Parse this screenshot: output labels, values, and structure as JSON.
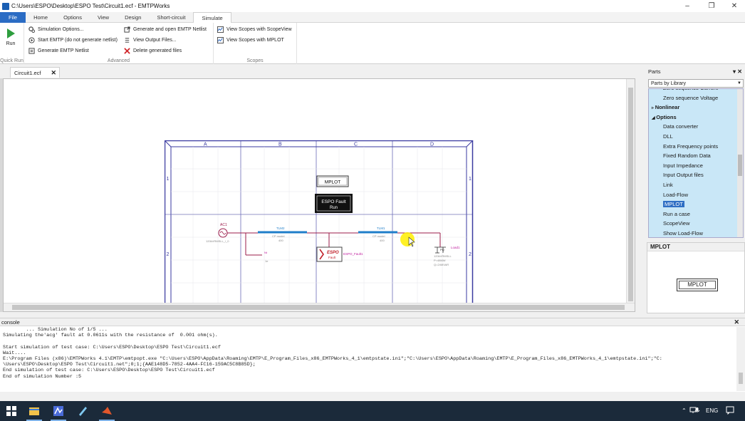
{
  "window": {
    "title": "C:\\Users\\ESPO\\Desktop\\ESPO Test\\Circuit1.ecf - EMTPWorks",
    "minimize": "–",
    "maximize": "❐",
    "close": "✕"
  },
  "menu_tabs": [
    "File",
    "Home",
    "Options",
    "View",
    "Design",
    "Short-circuit",
    "Simulate"
  ],
  "active_tab": "Simulate",
  "ribbon": {
    "run_label": "Run",
    "quick_run_label": "Quick Run",
    "advanced": {
      "label": "Advanced",
      "items": [
        "Simulation Options...",
        "Start EMTP (do not generate netlist)",
        "Generate EMTP Netlist",
        "Generate and open EMTP Netlist",
        "View Output Files...",
        "Delete generated files"
      ]
    },
    "scopes": {
      "label": "Scopes",
      "items": [
        "View Scopes with ScopeView",
        "View Scopes with MPLOT"
      ]
    }
  },
  "document_tab": {
    "label": "Circuit1.ecf",
    "close": "✕"
  },
  "schematic": {
    "columns": [
      "A",
      "B",
      "C",
      "D"
    ],
    "rows": [
      "1",
      "2"
    ],
    "mplot_label": "MPLOT",
    "espo_fault_line1": "ESPO Fault",
    "espo_fault_line2": "Run",
    "source_label": "AC1",
    "source_rating": "120kVRMSLL_/_0",
    "line1_label": "TLM2",
    "line1_type": "CP model",
    "line1_len": "400",
    "line2_label": "TLM1",
    "line2_type": "CP model",
    "line2_len": "400",
    "fault_block_label": "ESPO",
    "fault_block_sub": "Fault",
    "fault_tag": "ESPO_Fault1",
    "load_label": "Load1",
    "load_rating1": "120kVRMSLL",
    "load_rating2": "P=48MW",
    "load_rating3": "Q=24MVAR",
    "load_pq": "PQ",
    "ground_label": "Nt",
    "ground_value": "1e"
  },
  "console": {
    "title": "console",
    "close": "✕",
    "lines": [
      "        ... Simulation No of 1/5 ...",
      "Simulating the'acg' fault at 0.0611s with the resistance of  0.001 ohm(s).",
      "",
      "Start simulation of test case: C:\\Users\\ESPO\\Desktop\\ESPO Test\\Circuit1.ecf",
      "Wait....",
      "E:\\Program Files (x86)\\EMTPWorks 4.1\\EMTP\\emtpopt.exe \"C:\\Users\\ESPO\\AppData\\Roaming\\EMTP\\E_Program_Files_x86_EMTPWorks_4_1\\emtpstate.ini\";\"C:\\Users\\ESPO\\AppData\\Roaming\\EMTP\\E_Program_Files_x86_EMTPWorks_4_1\\emtpstate.ini\";\"C:",
      "\\Users\\ESPO\\Desktop\\ESPO Test\\Circuit1.net\";0;1;{AAE148D5-7852-4AA4-FC16-159AC5C8B85D};",
      "End simulation of test case: C:\\Users\\ESPO\\Desktop\\ESPO Test\\Circuit1.ecf",
      "End of simulation Number :5"
    ]
  },
  "parts": {
    "title": "Parts",
    "selector": "Parts by Library",
    "items": [
      {
        "label": "Zero sequence Current",
        "indent": 2
      },
      {
        "label": "Zero sequence Voltage",
        "indent": 2
      },
      {
        "label": "Nonlinear",
        "indent": 1,
        "bold": true,
        "expander": "▹"
      },
      {
        "label": "Options",
        "indent": 1,
        "bold": true,
        "expander": "◢"
      },
      {
        "label": "Data converter",
        "indent": 2
      },
      {
        "label": "DLL",
        "indent": 2
      },
      {
        "label": "Extra Frequency points",
        "indent": 2
      },
      {
        "label": "Fixed Random Data",
        "indent": 2
      },
      {
        "label": "Input Impedance",
        "indent": 2
      },
      {
        "label": "Input Output files",
        "indent": 2
      },
      {
        "label": "Link",
        "indent": 2
      },
      {
        "label": "Load-Flow",
        "indent": 2
      },
      {
        "label": "MPLOT",
        "indent": 2,
        "selected": true
      },
      {
        "label": "Run a case",
        "indent": 2
      },
      {
        "label": "ScopeView",
        "indent": 2
      },
      {
        "label": "Show Load-Flow",
        "indent": 2
      }
    ],
    "preview_title": "MPLOT",
    "preview_box": "MPLOT"
  },
  "taskbar": {
    "tray_lang": "ENG",
    "tray_arrow": "⌃"
  },
  "colors": {
    "accent": "#2b6cc4",
    "frame": "#3a3aa0",
    "wire": "#9b1b4a",
    "line": "#1f7ec9",
    "cursor_highlight": "#ffee00"
  }
}
